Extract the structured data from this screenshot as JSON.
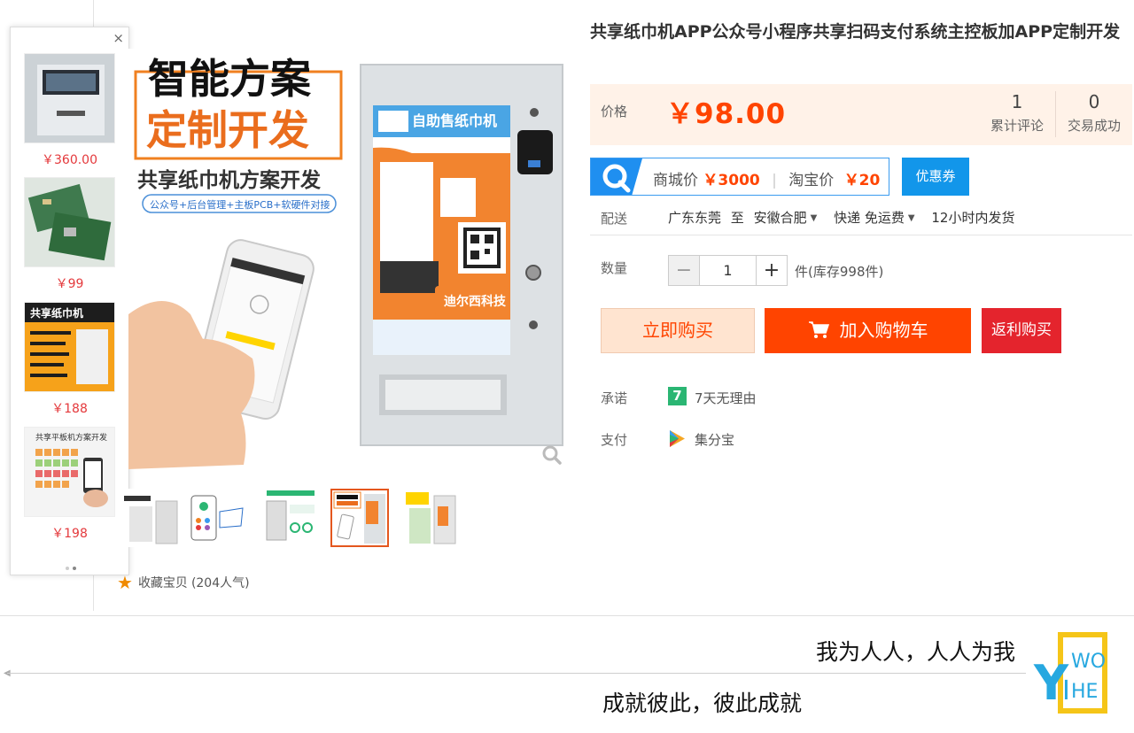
{
  "recommend": {
    "close_label": "×",
    "items": [
      {
        "price": "￥360.00"
      },
      {
        "price": "￥99"
      },
      {
        "price": "￥188",
        "thumb_title": "共享纸巾机"
      },
      {
        "price": "￥198",
        "thumb_title": "共享平板机方案开发"
      }
    ]
  },
  "main_image": {
    "headline1": "智能方案",
    "headline2": "定制开发",
    "subhead": "共享纸巾机方案开发",
    "tagline": "公众号+后台管理+主板PCB+软硬件对接",
    "machine_title": "自助售纸巾机",
    "machine_brand": "迪尔西科技"
  },
  "favorite": {
    "label": "收藏宝贝",
    "count": "(204人气)"
  },
  "product": {
    "title": "共享纸巾机APP公众号小程序共享扫码支付系统主控板加APP定制开发",
    "price_label": "价格",
    "price": "￥98.00",
    "stats": [
      {
        "num": "1",
        "label": "累计评论"
      },
      {
        "num": "0",
        "label": "交易成功"
      }
    ]
  },
  "coupon": {
    "mall_label": "商城价",
    "mall_price": "￥3000",
    "taobao_label": "淘宝价",
    "taobao_price": "￥20",
    "button": "优惠券"
  },
  "shipping": {
    "label": "配送",
    "from": "广东东莞",
    "to_word": "至",
    "to": "安徽合肥",
    "method": "快递 免运费",
    "dispatch": "12小时内发货"
  },
  "quantity": {
    "label": "数量",
    "minus": "−",
    "value": "1",
    "plus": "+",
    "stock": "件(库存998件)"
  },
  "actions": {
    "buy_now": "立即购买",
    "add_cart": "加入购物车",
    "rebate": "返利购买"
  },
  "promise": {
    "label": "承诺",
    "icon_text": "7",
    "text": "7天无理由"
  },
  "payment": {
    "label": "支付",
    "text": "集分宝"
  },
  "banner": {
    "slogan1": "我为人人，人人为我",
    "slogan2": "成就彼此，彼此成就",
    "logo_letters": "YIWOHE"
  },
  "colors": {
    "accent": "#ff4400",
    "price_red": "#f40",
    "coupon_blue": "#1296ea",
    "promise_green": "#2bb673"
  }
}
